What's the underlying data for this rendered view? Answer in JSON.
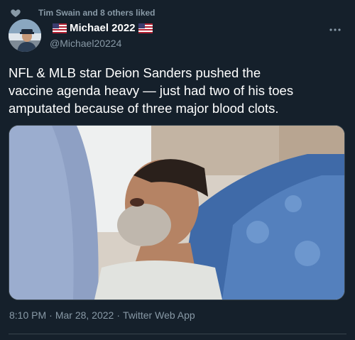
{
  "social_context": {
    "text": "Tim Swain and 8 others liked",
    "icon": "heart-icon"
  },
  "author": {
    "display_name": "Michael 2022",
    "handle": "@Michael20224",
    "flag_icon": "us-flag-icon"
  },
  "tweet": {
    "text": "NFL & MLB star Deion Sanders pushed the\nvaccine agenda heavy —  just had two of his toes\namputated because of three major blood clots."
  },
  "meta": {
    "time": "8:10 PM",
    "separator": "·",
    "date": "Mar 28, 2022",
    "source": "Twitter Web App"
  },
  "colors": {
    "background": "#15202b",
    "secondary_text": "#8899a6",
    "border": "#38444d"
  }
}
